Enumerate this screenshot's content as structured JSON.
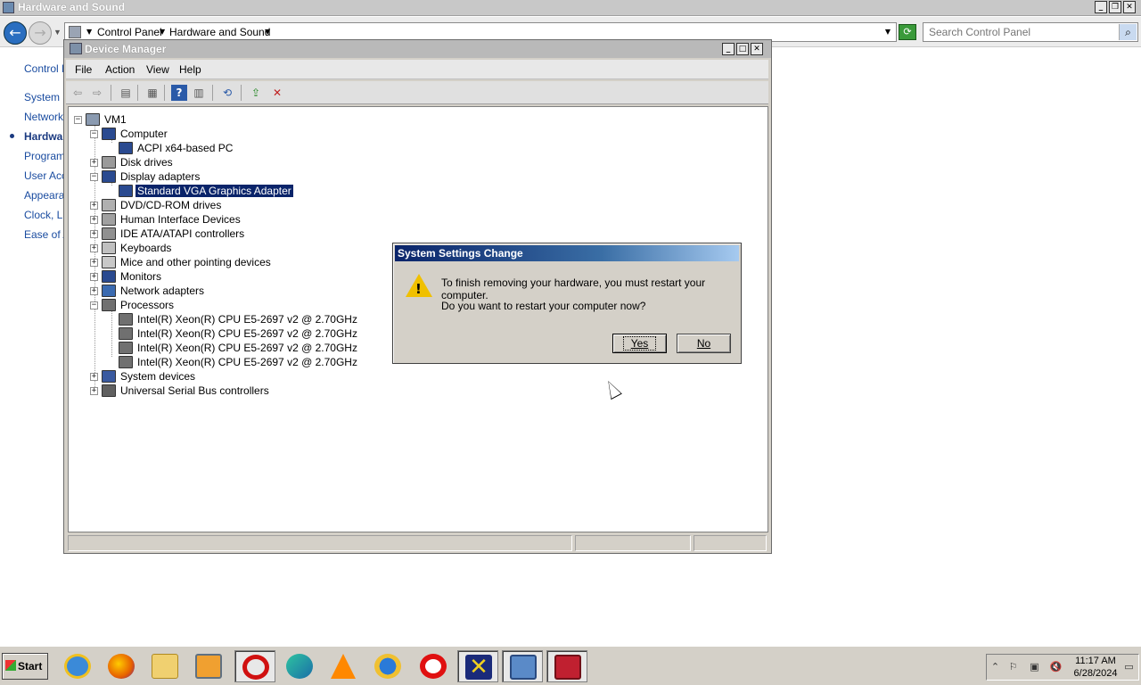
{
  "cp_window": {
    "title": "Hardware and Sound",
    "breadcrumb": [
      "Control Panel",
      "Hardware and Sound"
    ],
    "search_placeholder": "Search Control Panel",
    "sidebar": [
      {
        "label": "Control Panel Home",
        "active": false
      },
      {
        "label": "System and Security",
        "active": false
      },
      {
        "label": "Network and Internet",
        "active": false
      },
      {
        "label": "Hardware and Sound",
        "active": true
      },
      {
        "label": "Programs",
        "active": false
      },
      {
        "label": "User Accounts",
        "active": false
      },
      {
        "label": "Appearance",
        "active": false
      },
      {
        "label": "Clock, Language, and Region",
        "active": false
      },
      {
        "label": "Ease of Access",
        "active": false
      }
    ]
  },
  "device_manager": {
    "title": "Device Manager",
    "menu": [
      "File",
      "Action",
      "View",
      "Help"
    ],
    "toolbar": [
      "back-icon",
      "forward-icon",
      "show-hide-tree-icon",
      "properties-icon",
      "help-icon",
      "view-icon",
      "scan-icon",
      "update-driver-icon",
      "uninstall-icon"
    ],
    "tree": [
      {
        "label": "VM1",
        "level": 0,
        "expander": "−",
        "icon": "computer-icon"
      },
      {
        "label": "Computer",
        "level": 1,
        "expander": "−",
        "icon": "monitor-icon"
      },
      {
        "label": "ACPI x64-based PC",
        "level": 2,
        "expander": "",
        "icon": "monitor-icon"
      },
      {
        "label": "Disk drives",
        "level": 1,
        "expander": "+",
        "icon": "disk-icon"
      },
      {
        "label": "Display adapters",
        "level": 1,
        "expander": "−",
        "icon": "display-icon"
      },
      {
        "label": "Standard VGA Graphics Adapter",
        "level": 2,
        "expander": "",
        "icon": "display-icon",
        "selected": true
      },
      {
        "label": "DVD/CD-ROM drives",
        "level": 1,
        "expander": "+",
        "icon": "dvd-icon"
      },
      {
        "label": "Human Interface Devices",
        "level": 1,
        "expander": "+",
        "icon": "hid-icon"
      },
      {
        "label": "IDE ATA/ATAPI controllers",
        "level": 1,
        "expander": "+",
        "icon": "ide-icon"
      },
      {
        "label": "Keyboards",
        "level": 1,
        "expander": "+",
        "icon": "keyboard-icon"
      },
      {
        "label": "Mice and other pointing devices",
        "level": 1,
        "expander": "+",
        "icon": "mouse-icon"
      },
      {
        "label": "Monitors",
        "level": 1,
        "expander": "+",
        "icon": "monitor-icon"
      },
      {
        "label": "Network adapters",
        "level": 1,
        "expander": "+",
        "icon": "network-icon"
      },
      {
        "label": "Processors",
        "level": 1,
        "expander": "−",
        "icon": "cpu-icon"
      },
      {
        "label": "Intel(R) Xeon(R) CPU E5-2697 v2 @ 2.70GHz",
        "level": 2,
        "expander": "",
        "icon": "cpu-icon"
      },
      {
        "label": "Intel(R) Xeon(R) CPU E5-2697 v2 @ 2.70GHz",
        "level": 2,
        "expander": "",
        "icon": "cpu-icon"
      },
      {
        "label": "Intel(R) Xeon(R) CPU E5-2697 v2 @ 2.70GHz",
        "level": 2,
        "expander": "",
        "icon": "cpu-icon"
      },
      {
        "label": "Intel(R) Xeon(R) CPU E5-2697 v2 @ 2.70GHz",
        "level": 2,
        "expander": "",
        "icon": "cpu-icon"
      },
      {
        "label": "System devices",
        "level": 1,
        "expander": "+",
        "icon": "system-icon"
      },
      {
        "label": "Universal Serial Bus controllers",
        "level": 1,
        "expander": "+",
        "icon": "usb-icon"
      }
    ]
  },
  "dialog": {
    "title": "System Settings Change",
    "message1": "To finish removing your hardware, you must restart your computer.",
    "message2": "Do you want to restart your computer now?",
    "yes_label": "Yes",
    "no_label": "No"
  },
  "taskbar": {
    "start_label": "Start",
    "apps": [
      "internet-explorer-icon",
      "firefox-icon",
      "explorer-icon",
      "media-player-icon",
      "opera-icon",
      "edge-icon",
      "vlc-icon",
      "weather-icon",
      "opera-gx-icon",
      "xming-icon",
      "control-panel-icon",
      "device-manager-icon"
    ],
    "clock_time": "11:17 AM",
    "clock_date": "6/28/2024"
  },
  "colors": {
    "selection": "#0a246a",
    "link": "#1a4ca0",
    "dialog_title_start": "#0a246a",
    "dialog_title_end": "#a6caf0"
  }
}
